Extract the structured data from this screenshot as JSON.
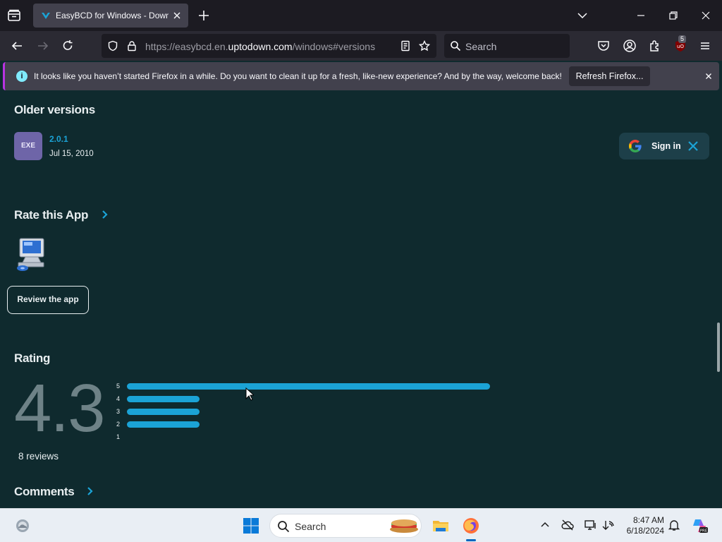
{
  "browser": {
    "tab_title": "EasyBCD for Windows - Downlo",
    "url_prefix": "https://easybcd.en.",
    "url_domain": "uptodown.com",
    "url_suffix": "/windows#versions",
    "search_placeholder": "Search",
    "extension_badge": "5",
    "notification_info_icon": "i",
    "notification_message": "It looks like you haven’t started Firefox in a while. Do you want to clean it up for a fresh, like-new experience? And by the way, welcome back!",
    "refresh_button": "Refresh Firefox..."
  },
  "page": {
    "older_versions_heading": "Older versions",
    "file_type": "EXE",
    "version": "2.0.1",
    "version_date": "Jul 15, 2010",
    "signin_label": "Sign in",
    "rate_heading": "Rate this App",
    "review_button": "Review the app",
    "rating_heading": "Rating",
    "rating_score": "4.3",
    "reviews_count": "8 reviews",
    "comments_heading": "Comments",
    "rating_distribution": [
      {
        "label": "5",
        "fraction": 1.0
      },
      {
        "label": "4",
        "fraction": 0.2
      },
      {
        "label": "3",
        "fraction": 0.2
      },
      {
        "label": "2",
        "fraction": 0.2
      },
      {
        "label": "1",
        "fraction": 0.0
      }
    ]
  },
  "taskbar": {
    "search_placeholder": "Search",
    "time": "8:47 AM",
    "date": "6/18/2024"
  },
  "colors": {
    "accent": "#1ba3d6",
    "page_background": "#0f2a2e",
    "exe_badge": "#6e65a8"
  }
}
